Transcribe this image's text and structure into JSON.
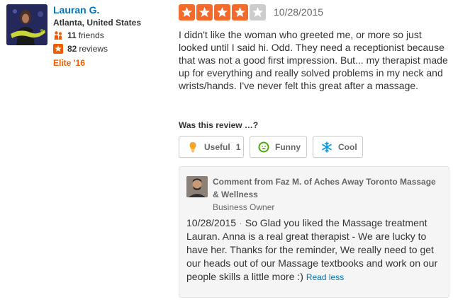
{
  "user": {
    "name": "Lauran G.",
    "location": "Atlanta, United States",
    "friends_count": "11",
    "friends_label": "friends",
    "reviews_count": "82",
    "reviews_label": "reviews",
    "elite": "Elite '16"
  },
  "review": {
    "rating": 4,
    "rating_max": 5,
    "date": "10/28/2015",
    "text": "I didn't like the woman who greeted me, or more so just looked until I said hi. Odd. They need a receptionist because that was not a good first impression. But... my therapist made up for everything and really solved problems in my neck and wrists/hands. I've never felt this great after a massage."
  },
  "votes": {
    "prompt": "Was this review …?",
    "useful_label": "Useful",
    "useful_count": "1",
    "funny_label": "Funny",
    "cool_label": "Cool"
  },
  "comment": {
    "from": "Comment from Faz M. of Aches Away Toronto Massage & Wellness",
    "role": "Business Owner",
    "date": "10/28/2015",
    "separator": "·",
    "text": "So Glad you liked the Massage treatment Lauran. Anna is a real great therapist - We are lucky to have her. Thanks for the reminder, We really need to get our heads out of our Massage textbooks and work on our people skills a little more :)",
    "read_less": "Read less"
  },
  "colors": {
    "link": "#0073bb",
    "star_on": "#f26b2c",
    "star_off": "#cccccc",
    "elite": "#f15c00"
  },
  "icons": {
    "friends": "friends-icon",
    "reviews": "star-icon",
    "useful": "lightbulb-icon",
    "funny": "smiley-icon",
    "cool": "snowflake-icon"
  }
}
